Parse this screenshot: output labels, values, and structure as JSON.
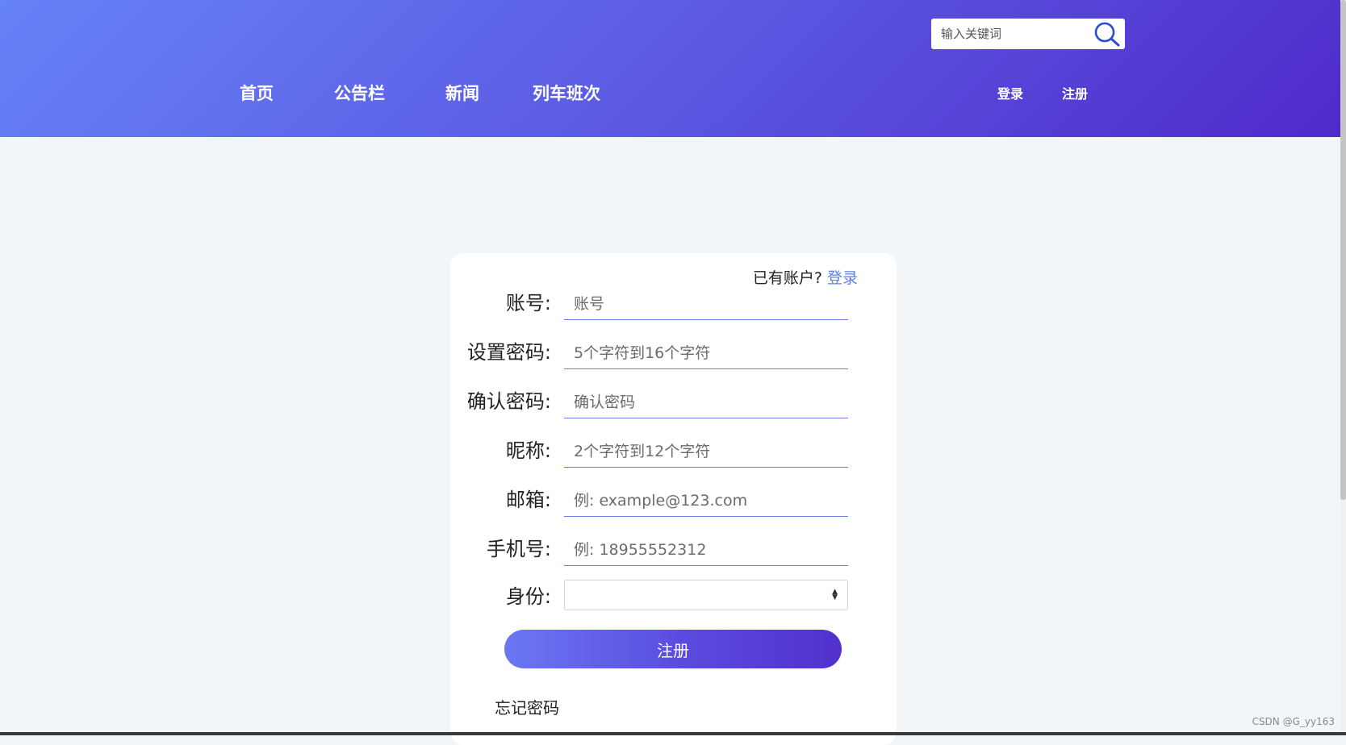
{
  "header": {
    "search": {
      "placeholder": "输入关键词"
    },
    "nav": [
      {
        "label": "首页"
      },
      {
        "label": "公告栏"
      },
      {
        "label": "新闻"
      },
      {
        "label": "列车班次"
      }
    ],
    "login_label": "登录",
    "register_label": "注册"
  },
  "form": {
    "have_account_text": "已有账户?",
    "login_link": "登录",
    "fields": [
      {
        "label": "账号:",
        "placeholder": "账号"
      },
      {
        "label": "设置密码:",
        "placeholder": "5个字符到16个字符"
      },
      {
        "label": "确认密码:",
        "placeholder": "确认密码"
      },
      {
        "label": "昵称:",
        "placeholder": "2个字符到12个字符"
      },
      {
        "label": "邮箱:",
        "placeholder": "例: example@123.com"
      },
      {
        "label": "手机号:",
        "placeholder": "例: 18955552312"
      }
    ],
    "identity_label": "身份:",
    "identity_value": "",
    "submit_label": "注册",
    "forgot_label": "忘记密码"
  },
  "watermark": "CSDN @G_yy163",
  "colors": {
    "header_gradient_start": "#6683f7",
    "header_gradient_end": "#4f2ac9",
    "link": "#5b7ef3",
    "input_underline": "#6a80e6"
  }
}
